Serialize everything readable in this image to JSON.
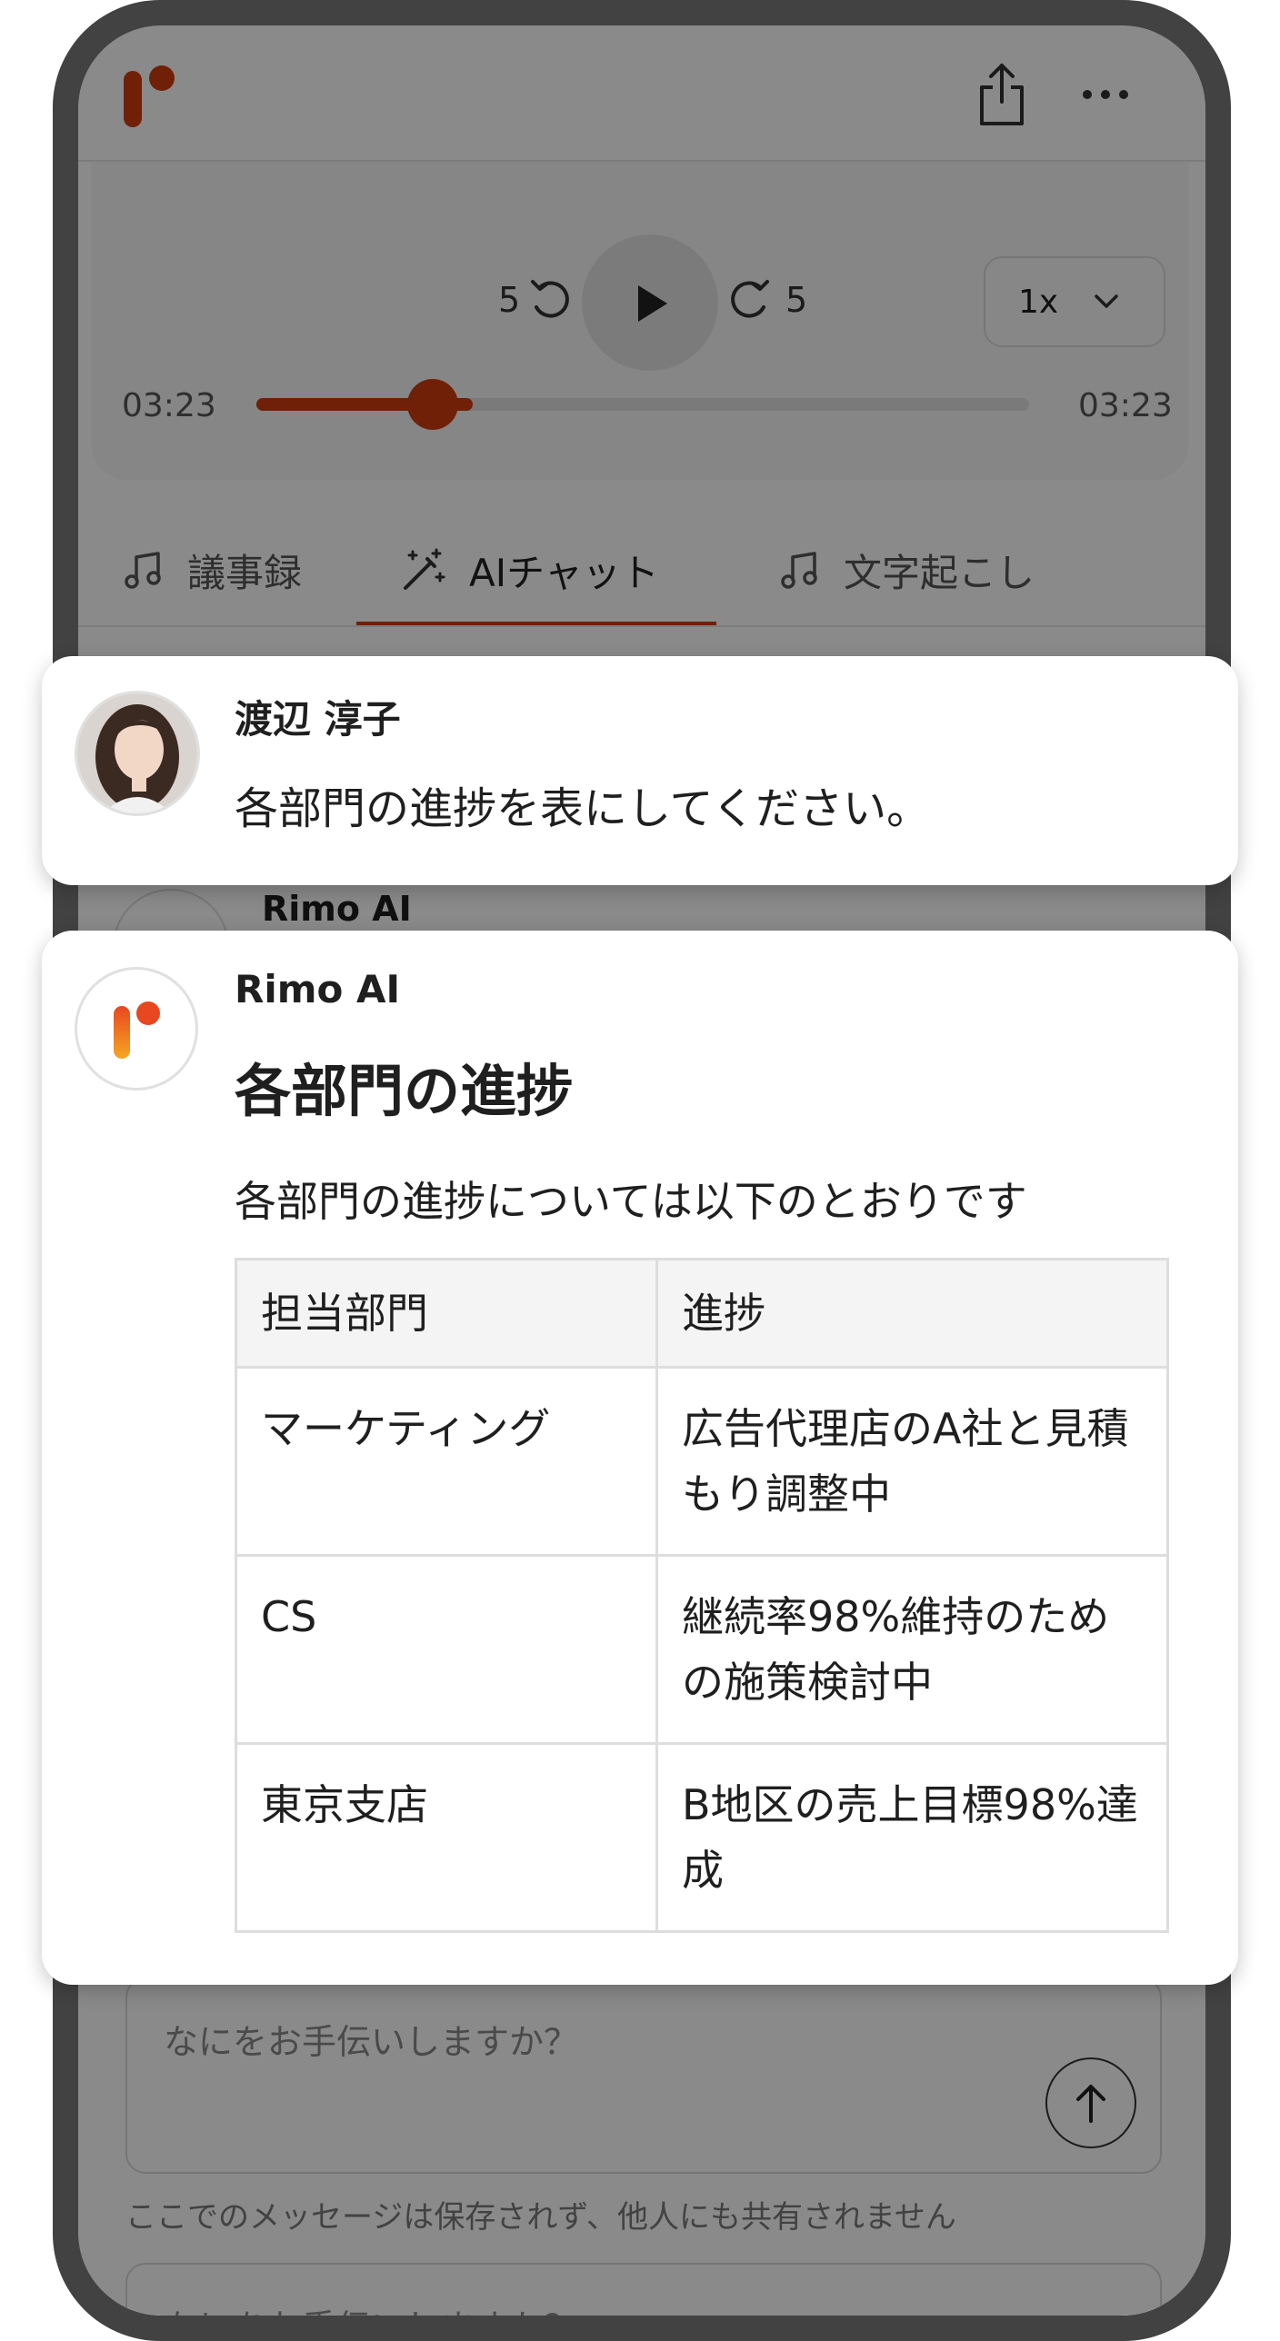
{
  "player": {
    "skip_back": "5",
    "skip_forward": "5",
    "speed": "1x",
    "time_elapsed": "03:23",
    "time_total": "03:23",
    "progress": 0.28
  },
  "tabs": [
    {
      "label": "議事録"
    },
    {
      "label": "AIチャット"
    },
    {
      "label": "文字起こし"
    }
  ],
  "user_message": {
    "name": "渡辺 淳子",
    "text": "各部門の進捗を表にしてください。"
  },
  "ai_message": {
    "name": "Rimo AI",
    "heading": "各部門の進捗",
    "intro": "各部門の進捗については以下のとおりです",
    "table": {
      "headers": [
        "担当部門",
        "進捗"
      ],
      "rows": [
        [
          "マーケティング",
          "広告代理店のA社と見積もり調整中"
        ],
        [
          "CS",
          "継続率98%維持のための施策検討中"
        ],
        [
          "東京支店",
          "B地区の売上目標98%達成"
        ]
      ]
    }
  },
  "background": {
    "ai_label": "Rimo AI",
    "input_placeholder": "なにをお手伝いしますか？",
    "disclaimer": "ここでのメッセージは保存されず、他人にも共有されません"
  },
  "colors": {
    "accent": "#cf3c0d",
    "logo_gradient_top": "#e8471f",
    "logo_gradient_bottom": "#f5a623"
  }
}
